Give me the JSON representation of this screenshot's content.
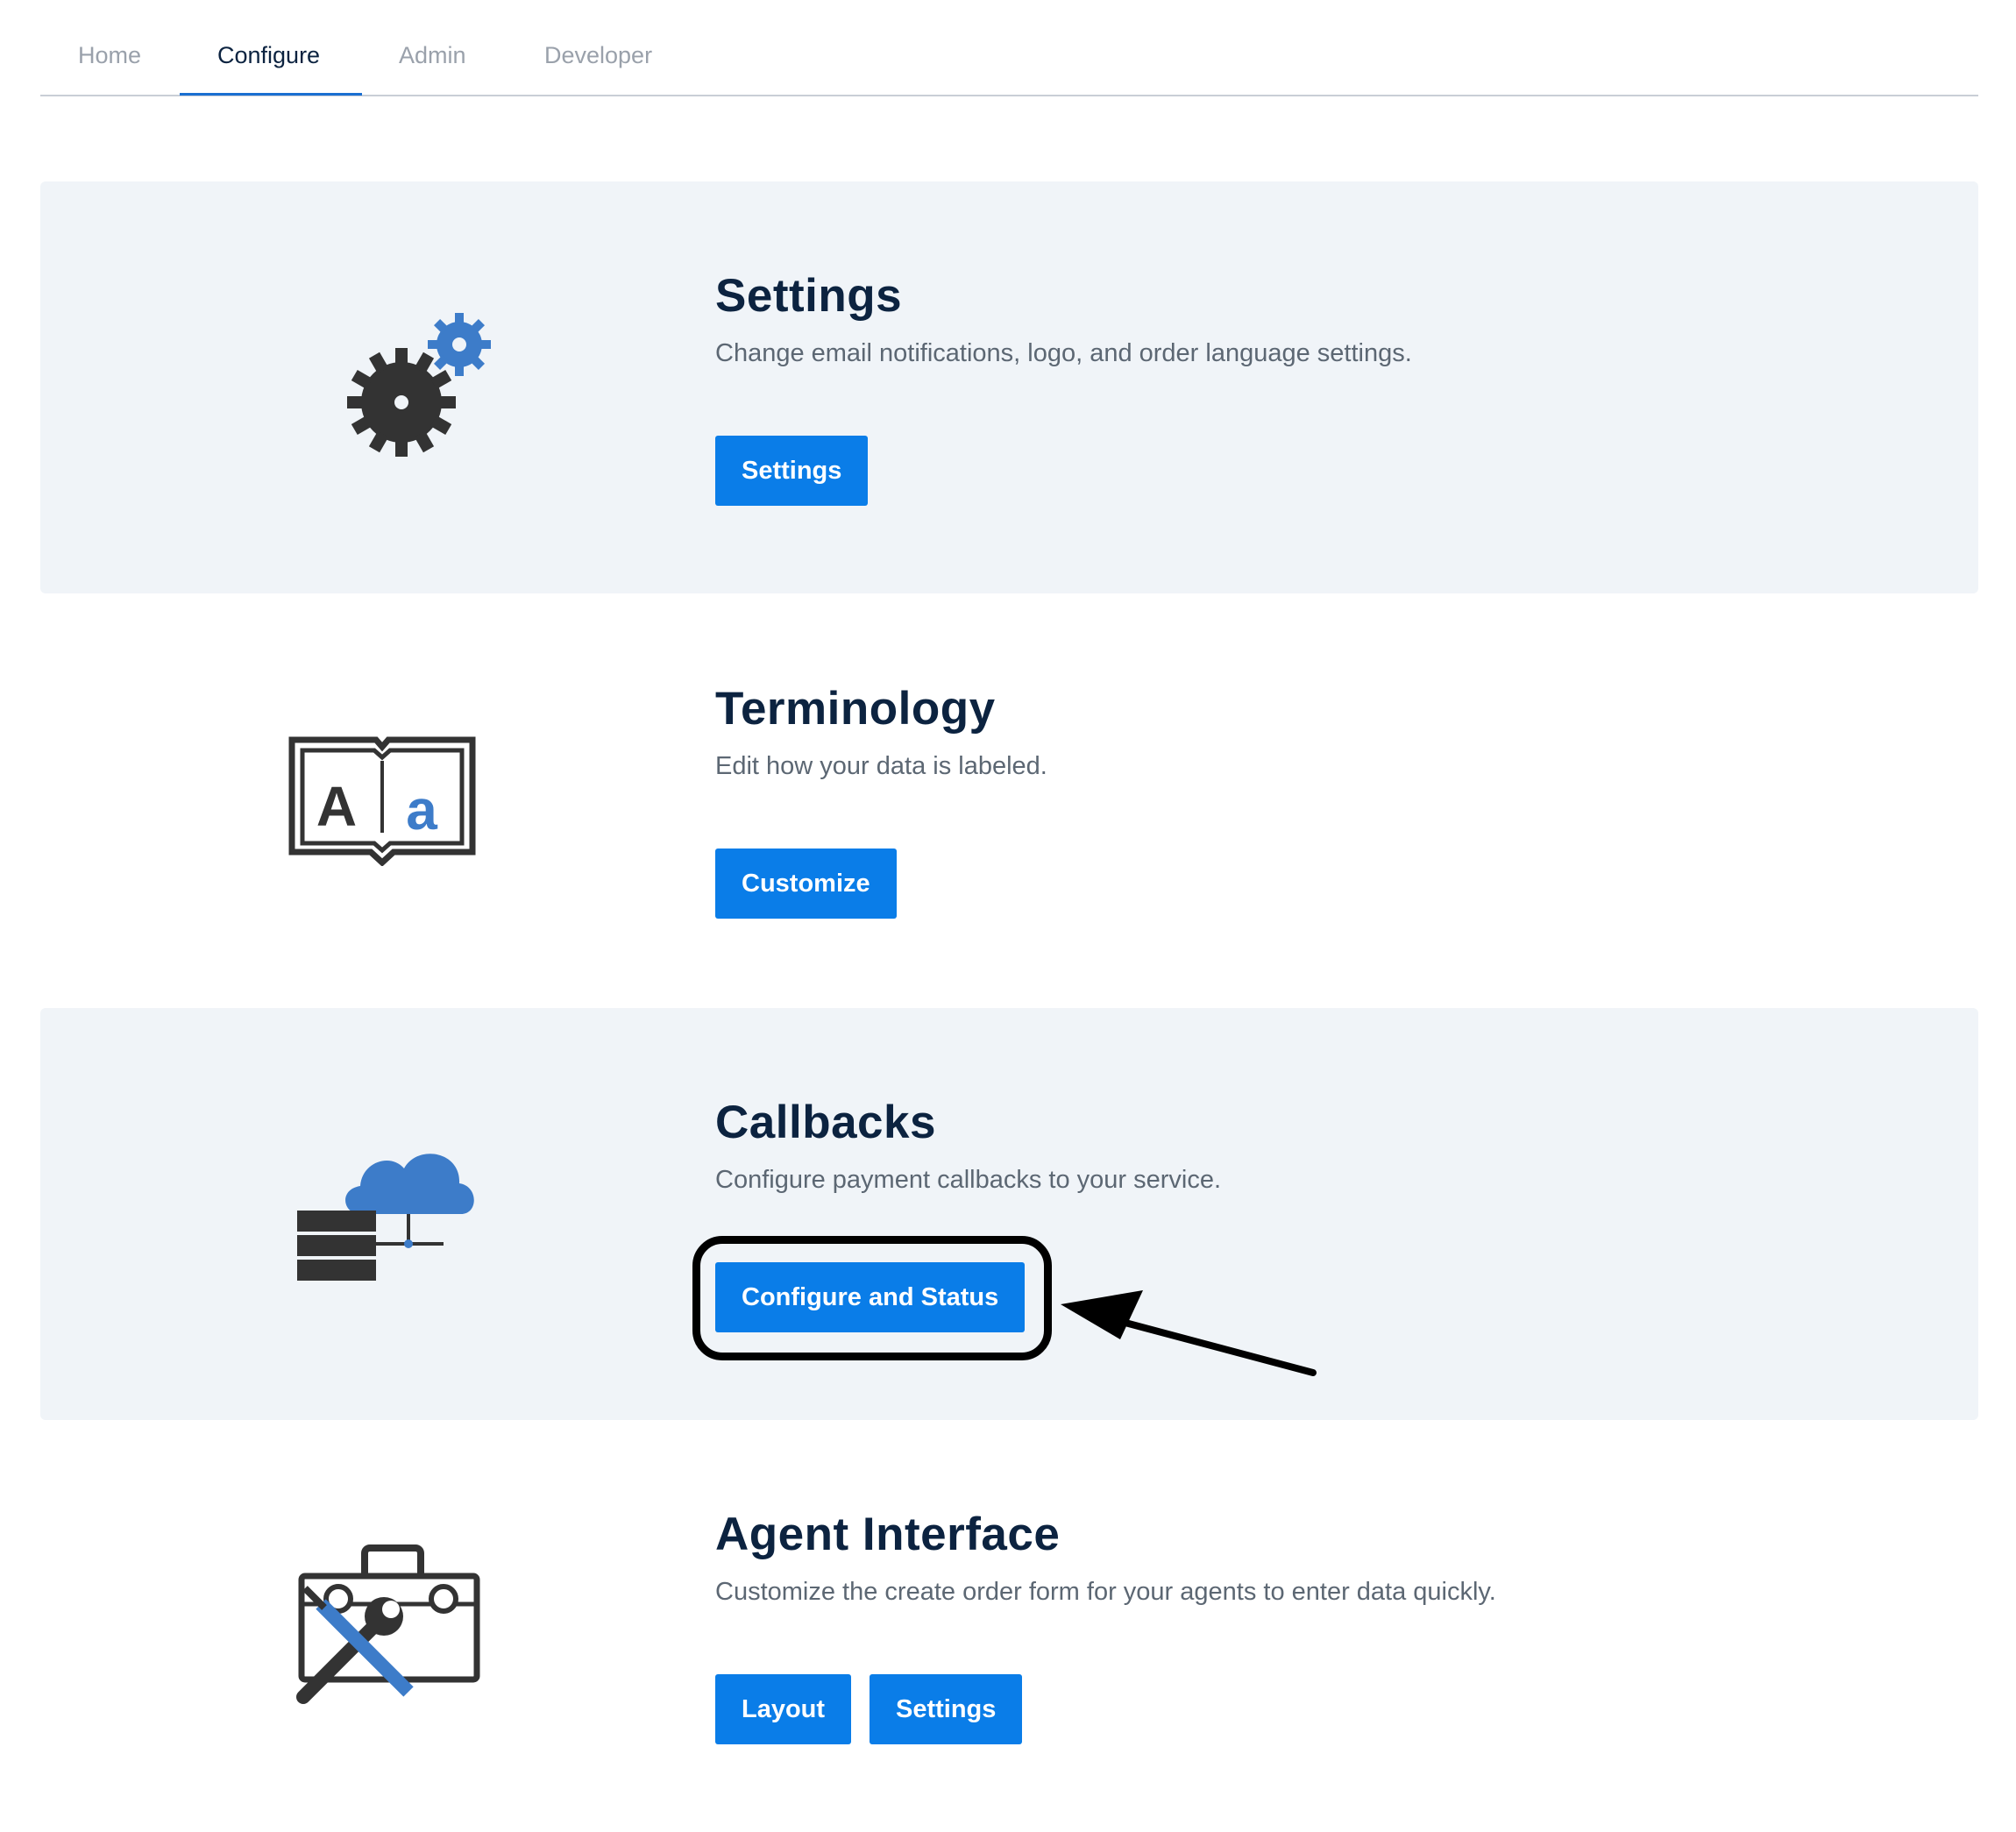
{
  "nav": {
    "tabs": [
      {
        "label": "Home"
      },
      {
        "label": "Configure"
      },
      {
        "label": "Admin"
      },
      {
        "label": "Developer"
      }
    ],
    "active_tab": "Configure"
  },
  "sections": {
    "settings": {
      "title": "Settings",
      "description": "Change email notifications, logo, and order language settings.",
      "buttons": [
        "Settings"
      ],
      "icon": "gears-icon"
    },
    "terminology": {
      "title": "Terminology",
      "description": "Edit how your data is labeled.",
      "buttons": [
        "Customize"
      ],
      "icon": "book-icon",
      "icon_letters": [
        "A",
        "a"
      ]
    },
    "callbacks": {
      "title": "Callbacks",
      "description": "Configure payment callbacks to your service.",
      "buttons": [
        "Configure and Status"
      ],
      "icon": "server-cloud-icon",
      "highlighted_button": "Configure and Status"
    },
    "agent_interface": {
      "title": "Agent Interface",
      "description": "Customize the create order form for your agents to enter data quickly.",
      "buttons": [
        "Layout",
        "Settings"
      ],
      "icon": "toolbox-icon"
    }
  },
  "colors": {
    "accent": "#0a7de8",
    "title": "#0c2340",
    "shaded_bg": "#f0f4f8",
    "icon_dark": "#333333",
    "icon_blue": "#3d7cc9"
  }
}
